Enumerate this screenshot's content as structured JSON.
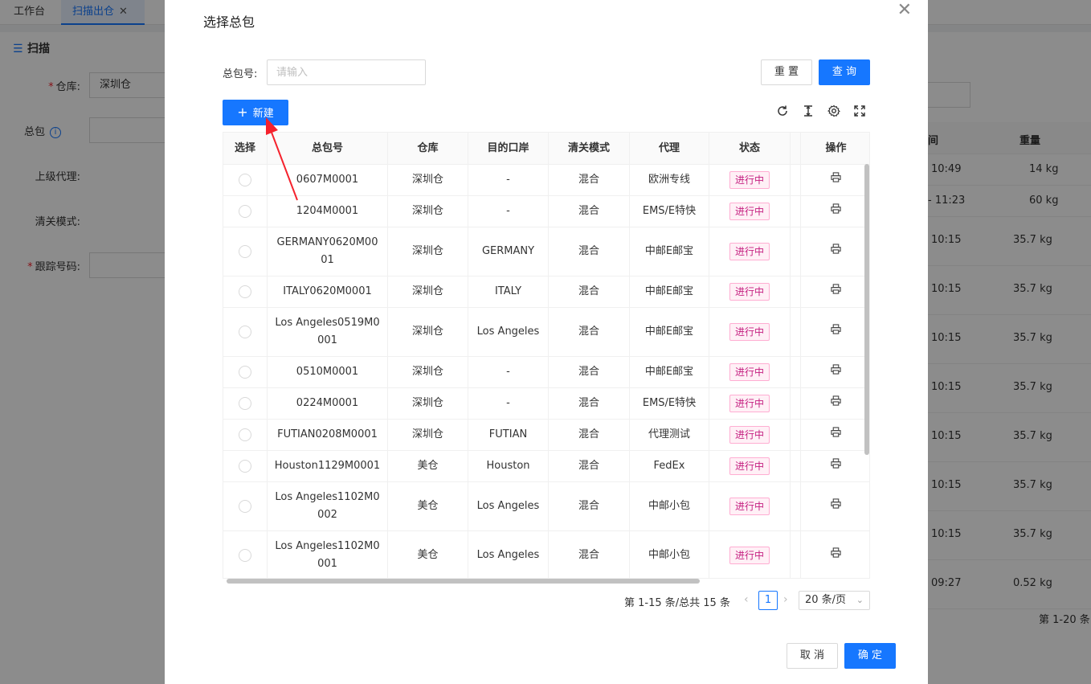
{
  "tabs": [
    {
      "label": "工作台"
    },
    {
      "label": "扫描出仓",
      "close": "✕"
    }
  ],
  "panel": {
    "title": "扫描",
    "fields": {
      "warehouse_label": "仓库:",
      "warehouse_value": "深圳仓",
      "package_label": "总包",
      "agent_label": "上级代理:",
      "clearance_label": "清关模式:",
      "tracking_label": "跟踪号码:"
    },
    "bg_table": {
      "col_time": "间",
      "col_weight": "重量",
      "rows": [
        {
          "time": "10:49",
          "weight": "14 kg"
        },
        {
          "time": "- 11:23",
          "weight": "60 kg"
        },
        {
          "time": "10:15",
          "weight": "35.7 kg"
        },
        {
          "time": "10:15",
          "weight": "35.7 kg"
        },
        {
          "time": "10:15",
          "weight": "35.7 kg"
        },
        {
          "time": "10:15",
          "weight": "35.7 kg"
        },
        {
          "time": "10:15",
          "weight": "35.7 kg"
        },
        {
          "time": "10:15",
          "weight": "35.7 kg"
        },
        {
          "time": "10:15",
          "weight": "35.7 kg"
        },
        {
          "time": "09:27",
          "weight": "0.52 kg"
        }
      ],
      "pagination": "第 1-20 条"
    }
  },
  "modal": {
    "title": "选择总包",
    "close": "✕",
    "query_label": "总包号:",
    "query_placeholder": "请输入",
    "reset_label": "重 置",
    "search_label": "查 询",
    "new_label": "新建",
    "cancel_label": "取 消",
    "ok_label": "确 定",
    "table": {
      "headers": [
        "选择",
        "总包号",
        "仓库",
        "目的口岸",
        "清关模式",
        "代理",
        "状态",
        "操作"
      ],
      "rows": [
        {
          "no": "0607M0001",
          "wh": "深圳仓",
          "dest": "-",
          "mode": "混合",
          "agent": "欧洲专线",
          "status": "进行中"
        },
        {
          "no": "1204M0001",
          "wh": "深圳仓",
          "dest": "-",
          "mode": "混合",
          "agent": "EMS/E特快",
          "status": "进行中"
        },
        {
          "no": "GERMANY0620M0001",
          "wh": "深圳仓",
          "dest": "GERMANY",
          "mode": "混合",
          "agent": "中邮E邮宝",
          "status": "进行中"
        },
        {
          "no": "ITALY0620M0001",
          "wh": "深圳仓",
          "dest": "ITALY",
          "mode": "混合",
          "agent": "中邮E邮宝",
          "status": "进行中"
        },
        {
          "no": "Los Angeles0519M0001",
          "wh": "深圳仓",
          "dest": "Los Angeles",
          "mode": "混合",
          "agent": "中邮E邮宝",
          "status": "进行中"
        },
        {
          "no": "0510M0001",
          "wh": "深圳仓",
          "dest": "-",
          "mode": "混合",
          "agent": "中邮E邮宝",
          "status": "进行中"
        },
        {
          "no": "0224M0001",
          "wh": "深圳仓",
          "dest": "-",
          "mode": "混合",
          "agent": "EMS/E特快",
          "status": "进行中"
        },
        {
          "no": "FUTIAN0208M0001",
          "wh": "深圳仓",
          "dest": "FUTIAN",
          "mode": "混合",
          "agent": "代理测试",
          "status": "进行中"
        },
        {
          "no": "Houston1129M0001",
          "wh": "美仓",
          "dest": "Houston",
          "mode": "混合",
          "agent": "FedEx",
          "status": "进行中"
        },
        {
          "no": "Los Angeles1102M0002",
          "wh": "美仓",
          "dest": "Los Angeles",
          "mode": "混合",
          "agent": "中邮小包",
          "status": "进行中"
        },
        {
          "no": "Los Angeles1102M0001",
          "wh": "美仓",
          "dest": "Los Angeles",
          "mode": "混合",
          "agent": "中邮小包",
          "status": "进行中"
        }
      ]
    },
    "pagination": {
      "total_text": "第 1-15 条/总共 15 条",
      "current_page": "1",
      "page_size": "20 条/页"
    }
  }
}
